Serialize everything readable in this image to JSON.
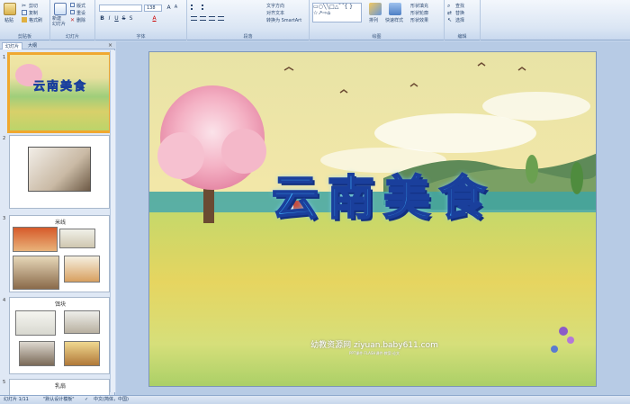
{
  "ribbon": {
    "clipboard": {
      "label": "剪贴板",
      "paste": "粘贴",
      "cut": "剪切",
      "copy": "复制",
      "format_painter": "格式刷"
    },
    "slides": {
      "label": "幻灯片",
      "new_slide": "新建\n幻灯片",
      "layout": "版式",
      "reset": "重设",
      "delete": "删除"
    },
    "font": {
      "label": "字体",
      "size": "138"
    },
    "paragraph": {
      "label": "段落",
      "text_direction": "文字方向",
      "align_text": "对齐文本",
      "smartart": "转换为 SmartArt"
    },
    "drawing": {
      "label": "绘图",
      "arrange": "排列",
      "quick_styles": "快速样式",
      "shape_fill": "形状填充",
      "shape_outline": "形状轮廓",
      "shape_effects": "形状效果"
    },
    "editing": {
      "label": "编辑",
      "find": "查找",
      "replace": "替换",
      "select": "选择"
    }
  },
  "panel": {
    "tabs": [
      "幻灯片",
      "大纲"
    ],
    "slides": [
      {
        "num": "1",
        "title": "云南美食"
      },
      {
        "num": "2",
        "caption": ""
      },
      {
        "num": "3",
        "caption": "米线"
      },
      {
        "num": "4",
        "caption": "饵块"
      },
      {
        "num": "5",
        "caption": "乳扇"
      }
    ]
  },
  "slide": {
    "title": "云南美食",
    "watermark": "幼教资源网 ziyuan.baby611.com",
    "watermark_small": "PPT课件·FLASH课件·教案·论文"
  },
  "status": {
    "slide_count": "幻灯片 1/11",
    "theme": "\"默认设计模板\"",
    "language": "中文(简体，中国)"
  },
  "colors": {
    "accent": "#3aa4f0",
    "ribbon": "#dbe6f4",
    "selection": "#f0a830"
  }
}
